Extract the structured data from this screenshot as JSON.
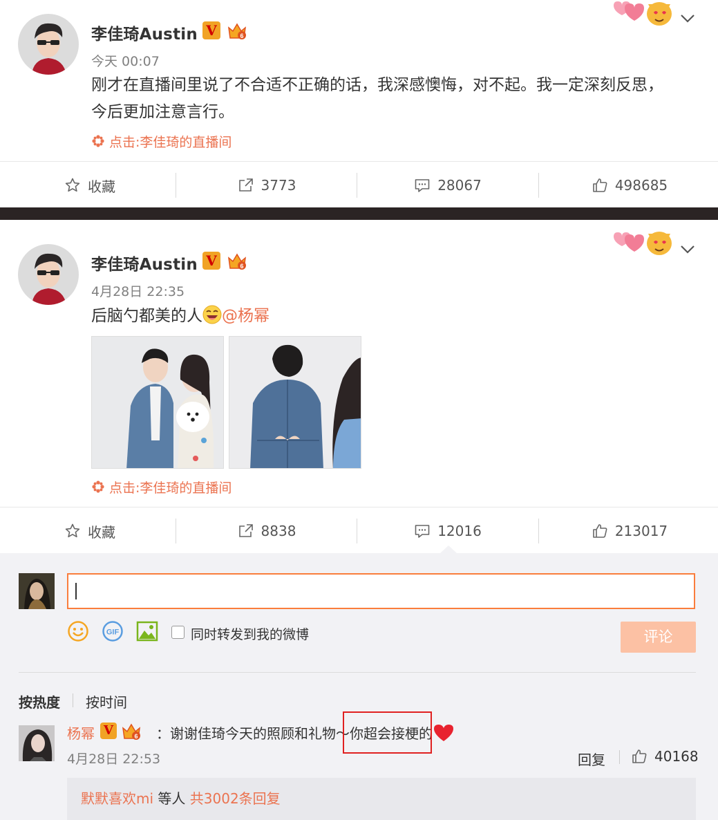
{
  "posts": [
    {
      "author": "李佳琦Austin",
      "verified_badge": "V",
      "time": "今天 00:07",
      "text": "刚才在直播间里说了不合适不正确的话，我深感懊悔，对不起。我一定深刻反思，今后更加注意言行。",
      "live_link": "点击:李佳琦的直播间",
      "actions": {
        "favorite": "收藏",
        "repost": "3773",
        "comment": "28067",
        "like": "498685"
      }
    },
    {
      "author": "李佳琦Austin",
      "verified_badge": "V",
      "time": "4月28日 22:35",
      "text": "后脑勺都美的人",
      "mention": "@杨幂",
      "live_link": "点击:李佳琦的直播间",
      "actions": {
        "favorite": "收藏",
        "repost": "8838",
        "comment": "12016",
        "like": "213017"
      }
    }
  ],
  "composer": {
    "share_checkbox_label": "同时转发到我的微博",
    "submit_label": "评论",
    "gif_label": "GIF"
  },
  "sort": {
    "hot": "按热度",
    "time": "按时间"
  },
  "comment": {
    "author": "杨幂",
    "verified_badge": "V",
    "text": "：谢谢佳琦今天的照顾和礼物～你超会接梗的",
    "time": "4月28日 22:53",
    "reply_label": "回复",
    "likes": "40168",
    "sub_replies": {
      "user": "默默喜欢mi",
      "middle": " 等人 ",
      "count": "共3002条回复"
    }
  },
  "colors": {
    "accent": "#eb7350",
    "submit_disabled": "#fcc1a4",
    "highlight_box": "#e02020"
  }
}
